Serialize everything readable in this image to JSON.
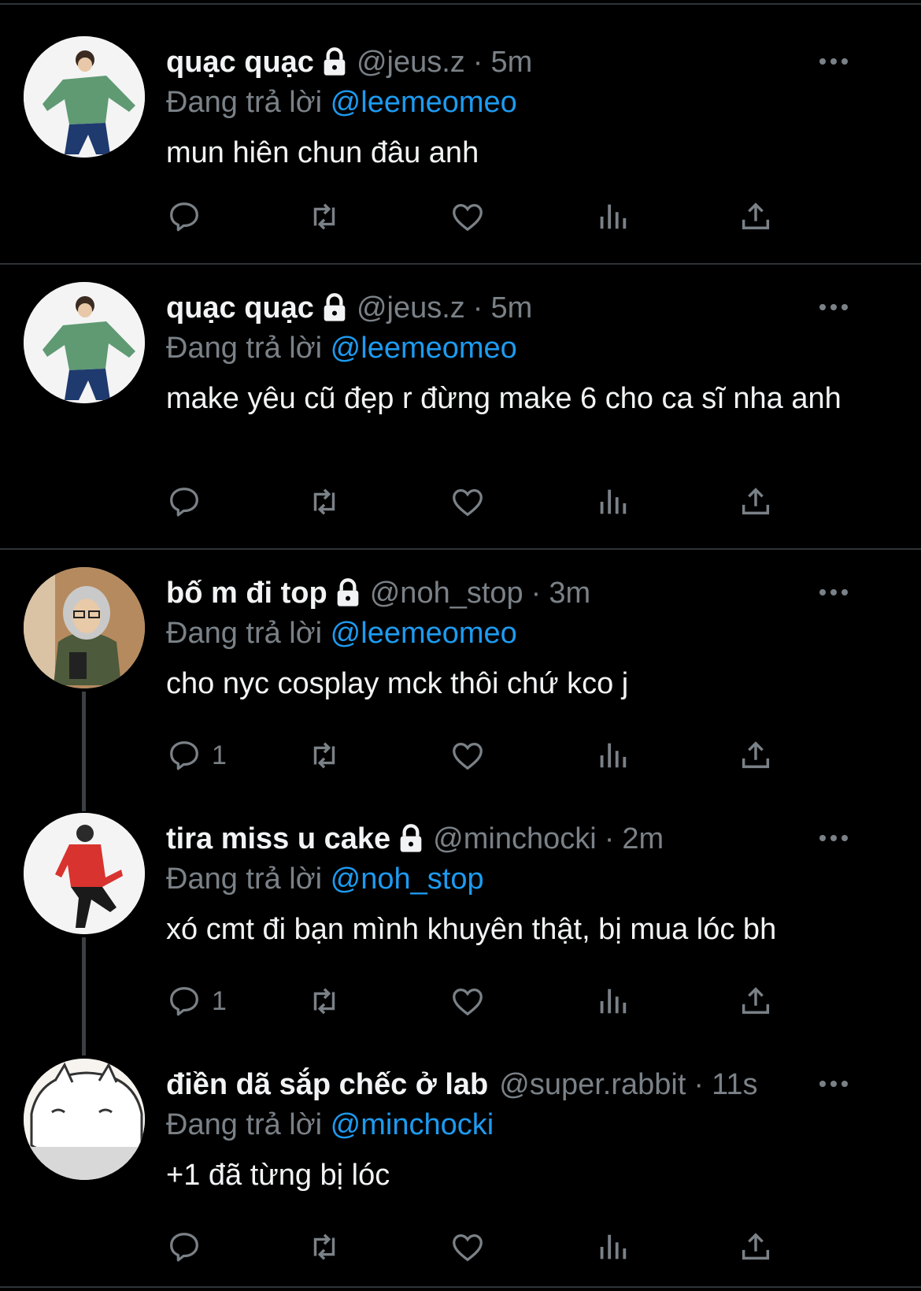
{
  "tweets": [
    {
      "name": "quạc quạc",
      "handle": "@jeus.z",
      "separator": "·",
      "time": "5m",
      "reply_prefix": "Đang trả lời",
      "reply_to": "@leemeomeo",
      "text": "mun hiên chun đâu anh",
      "reply_count": "",
      "avatar": "person-green-jacket"
    },
    {
      "name": "quạc quạc",
      "handle": "@jeus.z",
      "separator": "·",
      "time": "5m",
      "reply_prefix": "Đang trả lời",
      "reply_to": "@leemeomeo",
      "text": "make yêu cũ đẹp r đừng make 6 cho ca sĩ nha anh",
      "reply_count": "",
      "avatar": "person-green-jacket"
    },
    {
      "name": "bố m đi top",
      "handle": "@noh_stop",
      "separator": "·",
      "time": "3m",
      "reply_prefix": "Đang trả lời",
      "reply_to": "@leemeomeo",
      "text": "cho nyc cosplay mck thôi chứ kco j",
      "reply_count": "1",
      "avatar": "person-hoodie-selfie"
    },
    {
      "name": "tira miss u cake",
      "handle": "@minchocki",
      "separator": "·",
      "time": "2m",
      "reply_prefix": "Đang trả lời",
      "reply_to": "@noh_stop",
      "text": "xó cmt đi bạn mình khuyên thật, bị mua lóc bh",
      "reply_count": "1",
      "avatar": "person-red-jacket"
    },
    {
      "name": "điền dã sắp chếc ở lab",
      "handle": "@super.rabbit",
      "separator": "·",
      "time": "11s",
      "reply_prefix": "Đang trả lời",
      "reply_to": "@minchocki",
      "text": "+1 đã từng bị lóc",
      "reply_count": "",
      "avatar": "cartoon-cat"
    }
  ],
  "icons": {
    "reply": "reply-icon",
    "retweet": "retweet-icon",
    "like": "like-icon",
    "views": "views-icon",
    "share": "share-icon",
    "more": "more-icon",
    "lock": "lock-icon"
  },
  "colors": {
    "background": "#000000",
    "mention": "#1d9bf0",
    "muted": "#7a8187",
    "divider": "#2f3336"
  }
}
